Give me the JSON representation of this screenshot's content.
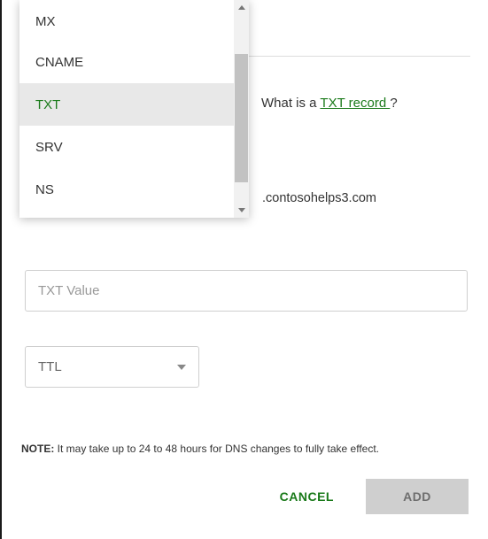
{
  "dropdown": {
    "options": [
      {
        "label": "MX",
        "selected": false
      },
      {
        "label": "CNAME",
        "selected": false
      },
      {
        "label": "TXT",
        "selected": true
      },
      {
        "label": "SRV",
        "selected": false
      },
      {
        "label": "NS",
        "selected": false
      }
    ]
  },
  "help": {
    "prefix": "What is a ",
    "link_text": "TXT record ",
    "suffix": "?"
  },
  "domain_suffix": ".contosohelps3.com",
  "txt_value_placeholder": "TXT Value",
  "ttl_label": "TTL",
  "note": {
    "label": "NOTE:",
    "text": " It may take up to 24 to 48 hours for DNS changes to fully take effect."
  },
  "buttons": {
    "cancel": "CANCEL",
    "add": "ADD"
  }
}
